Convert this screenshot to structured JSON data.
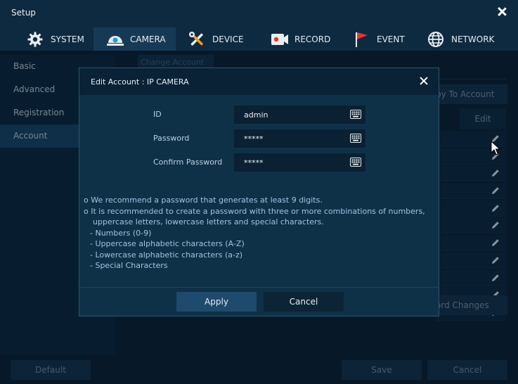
{
  "window": {
    "title": "Setup"
  },
  "tabs": [
    {
      "label": "SYSTEM",
      "icon": "gear-icon"
    },
    {
      "label": "CAMERA",
      "icon": "camera-icon"
    },
    {
      "label": "DEVICE",
      "icon": "tools-icon"
    },
    {
      "label": "RECORD",
      "icon": "record-icon"
    },
    {
      "label": "EVENT",
      "icon": "flag-icon"
    },
    {
      "label": "NETWORK",
      "icon": "globe-icon"
    }
  ],
  "active_tab": "CAMERA",
  "sidebar": {
    "items": [
      {
        "label": "Basic"
      },
      {
        "label": "Advanced"
      },
      {
        "label": "Registration"
      },
      {
        "label": "Account"
      }
    ],
    "active": "Account"
  },
  "background": {
    "tab_label": "Change Account",
    "copy_button": "py To Account",
    "edit_header": "Edit",
    "password_changes_button": "ord Changes"
  },
  "footer": {
    "default_label": "Default",
    "save_label": "Save",
    "cancel_label": "Cancel"
  },
  "dialog": {
    "title": "Edit Account : IP CAMERA",
    "fields": {
      "id_label": "ID",
      "id_value": "admin",
      "password_label": "Password",
      "password_value": "*****",
      "confirm_label": "Confirm Password",
      "confirm_value": "*****"
    },
    "notes": {
      "line1": "o We recommend a password that generates at least 9 digits.",
      "line2": "o It is recommended to create a password with three or more combinations of numbers,",
      "line3": "uppercase letters, lowercase letters and special characters.",
      "items": [
        "- Numbers (0-9)",
        "- Uppercase alphabetic characters (A-Z)",
        "- Lowercase alphabetic characters (a-z)",
        "- Special Characters"
      ]
    },
    "apply_label": "Apply",
    "cancel_label": "Cancel"
  },
  "colors": {
    "background": "#0e2a40",
    "active_tab": "#163a56",
    "active_sidebar": "#1a4a6e",
    "dialog_bg": "#0f3147",
    "note_text": "#9fc3e4",
    "event_flag": "#e8372c"
  }
}
